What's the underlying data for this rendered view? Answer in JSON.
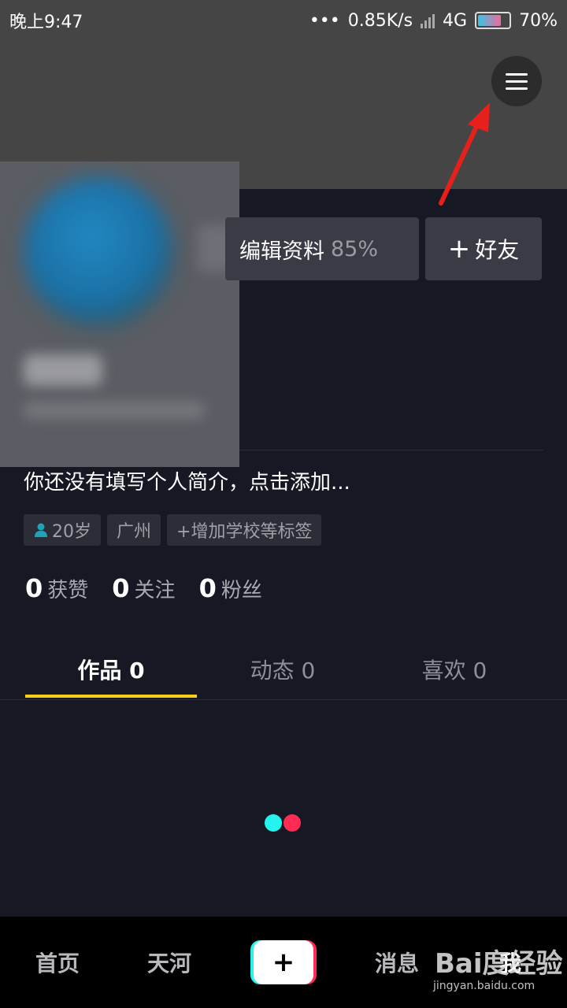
{
  "status_bar": {
    "time": "晚上9:47",
    "dots": "•••",
    "network_speed": "0.85K/s",
    "network_type": "4G",
    "battery": "70%"
  },
  "header": {
    "menu_icon": "hamburger-menu-icon",
    "annotation_arrow_color": "#e8201c"
  },
  "actions": {
    "edit_label": "编辑资料",
    "edit_percent": "85%",
    "add_friend_plus": "+",
    "add_friend_label": "好友"
  },
  "profile": {
    "bio": "你还没有填写个人简介，点击添加...",
    "tags": [
      {
        "icon": "person-icon",
        "label": "20岁"
      },
      {
        "label": "广州"
      },
      {
        "icon": "plus-icon",
        "label": "+增加学校等标签"
      }
    ],
    "stats": [
      {
        "value": "0",
        "label": "获赞"
      },
      {
        "value": "0",
        "label": "关注"
      },
      {
        "value": "0",
        "label": "粉丝"
      }
    ]
  },
  "tabs": [
    {
      "label": "作品 0",
      "active": true
    },
    {
      "label": "动态 0",
      "active": false
    },
    {
      "label": "喜欢 0",
      "active": false
    }
  ],
  "bottom_nav": {
    "home": "首页",
    "tianhe": "天河",
    "publish": "+",
    "messages": "消息",
    "me": "我"
  },
  "watermark": {
    "brand": "Bai度经验",
    "url": "jingyan.baidu.com"
  },
  "colors": {
    "background": "#161823",
    "tab_underline": "#face15",
    "loader_cyan": "#25f4ee",
    "loader_red": "#fe2c55"
  }
}
